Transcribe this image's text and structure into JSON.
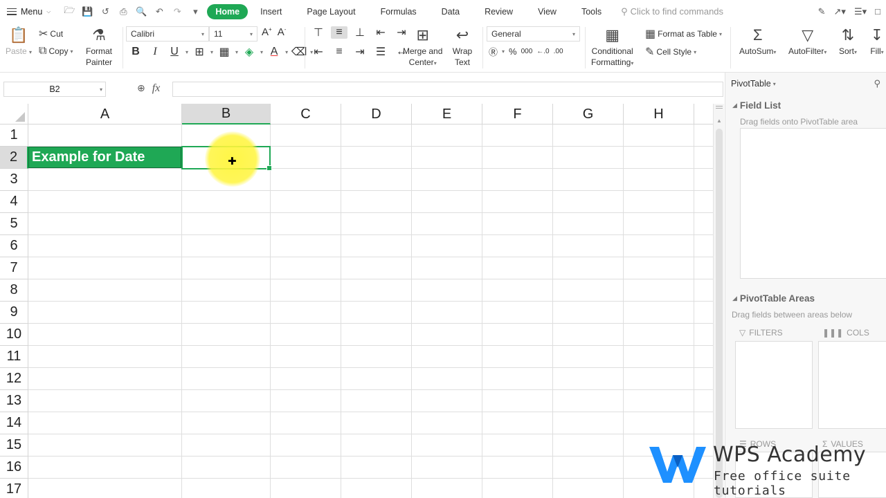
{
  "menubar": {
    "menu_label": "Menu",
    "tabs": [
      {
        "label": "Home",
        "active": true
      },
      {
        "label": "Insert"
      },
      {
        "label": "Page Layout"
      },
      {
        "label": "Formulas"
      },
      {
        "label": "Data"
      },
      {
        "label": "Review"
      },
      {
        "label": "View"
      },
      {
        "label": "Tools"
      }
    ],
    "search_placeholder": "Click to find commands"
  },
  "ribbon": {
    "paste": "Paste",
    "cut": "Cut",
    "copy": "Copy",
    "format_painter_1": "Format",
    "format_painter_2": "Painter",
    "font_name": "Calibri",
    "font_size": "11",
    "bold": "B",
    "italic": "I",
    "underline": "U",
    "merge_1": "Merge and",
    "merge_2": "Center",
    "wrap_1": "Wrap",
    "wrap_2": "Text",
    "number_format": "General",
    "conditional_1": "Conditional",
    "conditional_2": "Formatting",
    "format_as_table": "Format as Table",
    "cell_style": "Cell Style",
    "autosum": "AutoSum",
    "autofilter": "AutoFilter",
    "sort": "Sort",
    "fill": "Fill"
  },
  "formula_bar": {
    "name_box": "B2",
    "fx": "fx",
    "value": ""
  },
  "grid": {
    "columns": [
      "A",
      "B",
      "C",
      "D",
      "E",
      "F",
      "G",
      "H"
    ],
    "rows": [
      "1",
      "2",
      "3",
      "4",
      "5",
      "6",
      "7",
      "8",
      "9",
      "10",
      "11",
      "12",
      "13",
      "14",
      "15",
      "16",
      "17"
    ],
    "selected_cell": "B2",
    "cells": {
      "A2": "Example for Date"
    },
    "header_fill_color": "#1fa855"
  },
  "pivot_panel": {
    "title": "PivotTable",
    "field_list_title": "Field List",
    "field_list_hint": "Drag fields onto PivotTable area",
    "areas_title": "PivotTable Areas",
    "areas_hint": "Drag fields between areas below",
    "filters": "FILTERS",
    "cols": "COLS",
    "rows": "ROWS",
    "values": "VALUES"
  },
  "watermark": {
    "title": "WPS Academy",
    "subtitle": "Free office suite tutorials"
  },
  "colors": {
    "accent": "#1fa855"
  }
}
